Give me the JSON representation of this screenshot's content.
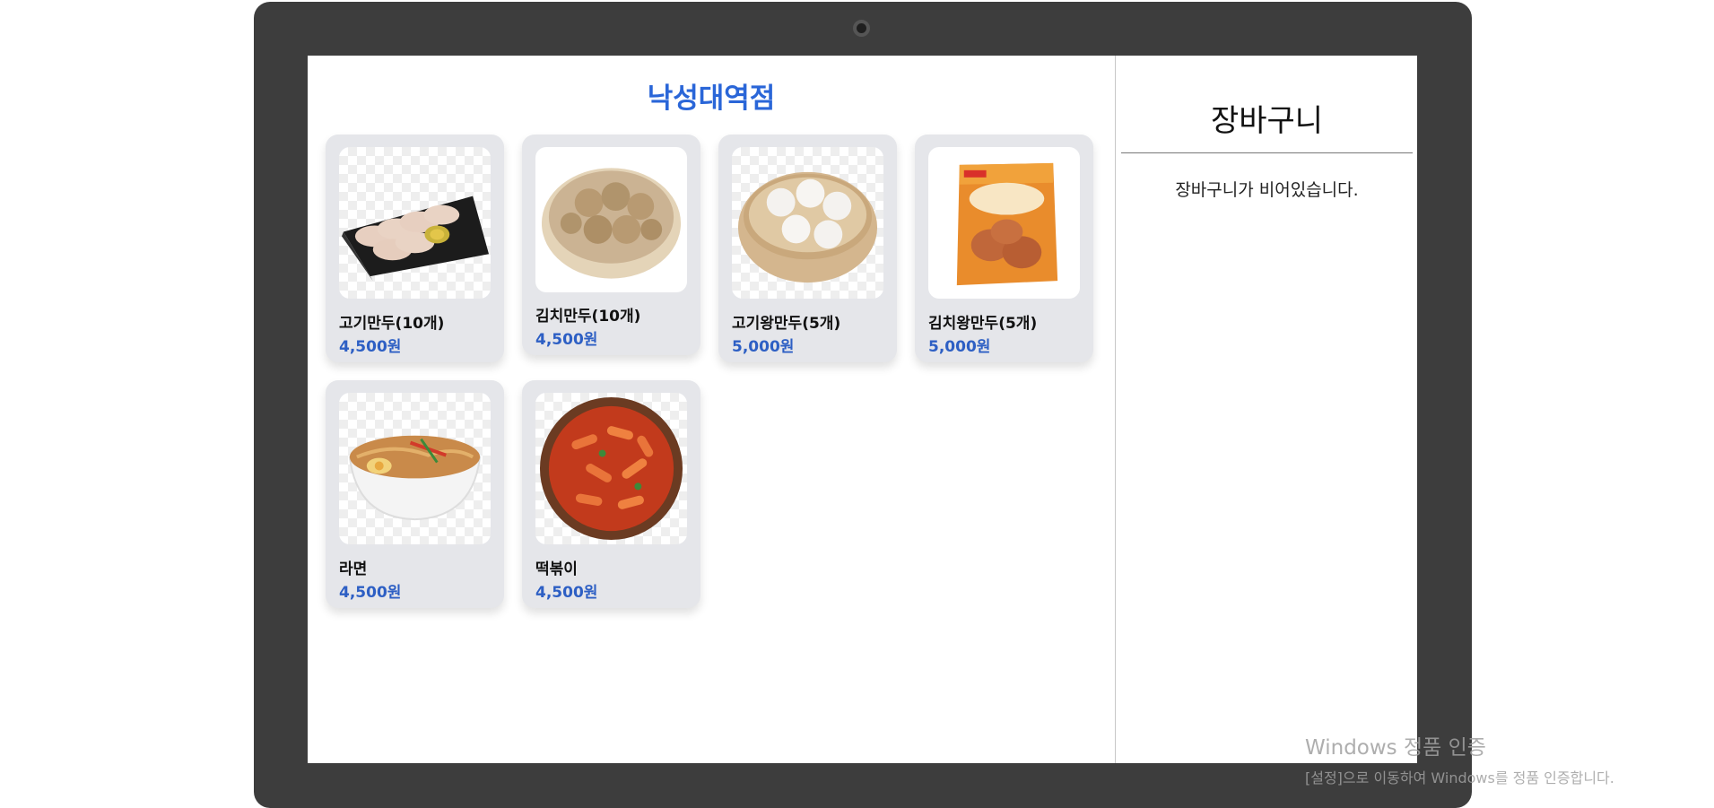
{
  "store": {
    "title": "낙성대역점"
  },
  "menu": {
    "items": [
      {
        "name": "고기만두(10개)",
        "price": "4,500원",
        "image": "meat-dumplings-image"
      },
      {
        "name": "김치만두(10개)",
        "price": "4,500원",
        "image": "kimchi-dumplings-image"
      },
      {
        "name": "고기왕만두(5개)",
        "price": "5,000원",
        "image": "meat-king-dumplings-image"
      },
      {
        "name": "김치왕만두(5개)",
        "price": "5,000원",
        "image": "kimchi-king-dumplings-image"
      },
      {
        "name": "라면",
        "price": "4,500원",
        "image": "ramen-image"
      },
      {
        "name": "떡볶이",
        "price": "4,500원",
        "image": "tteokbokki-image"
      }
    ]
  },
  "cart": {
    "title": "장바구니",
    "empty_message": "장바구니가 비어있습니다."
  },
  "watermark": {
    "title": "Windows 정품 인증",
    "subtitle": "[설정]으로 이동하여 Windows를 정품 인증합니다."
  },
  "colors": {
    "accent": "#2a66d8",
    "price": "#2d5fc4",
    "card_bg": "#e5e6ea",
    "frame": "#3d3d3d"
  }
}
